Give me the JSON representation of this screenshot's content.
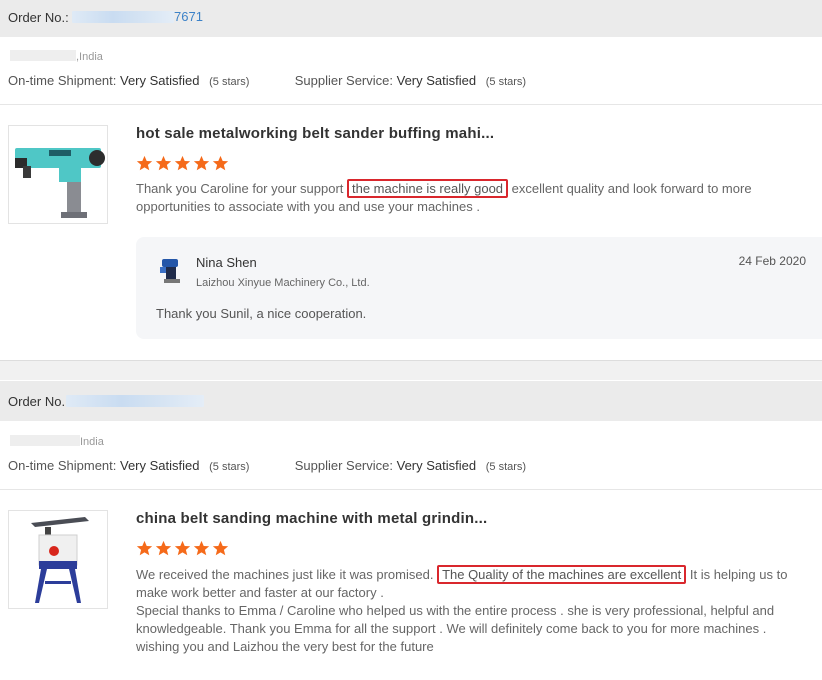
{
  "orders": [
    {
      "order_label": "Order No.:",
      "order_number_visible": "7671",
      "location": ",India",
      "ontime_label": "On-time Shipment:",
      "ontime_value": "Very Satisfied",
      "ontime_stars": "(5 stars)",
      "supplier_label": "Supplier Service:",
      "supplier_value": "Very Satisfied",
      "supplier_stars": "(5 stars)",
      "product_title": "hot sale metalworking belt sander buffing mahi...",
      "rating": 5,
      "review_before": "Thank you Caroline for your support ",
      "review_highlight": "the machine is really good",
      "review_after": " excellent quality and look forward to more opportunities to associate with you and use your machines .",
      "reply": {
        "name": "Nina Shen",
        "company": "Laizhou Xinyue Machinery Co., Ltd.",
        "date": "24 Feb 2020",
        "text": "Thank you Sunil, a nice cooperation."
      }
    },
    {
      "order_label": "Order No.",
      "location": "India",
      "ontime_label": "On-time Shipment:",
      "ontime_value": "Very Satisfied",
      "ontime_stars": "(5 stars)",
      "supplier_label": "Supplier Service:",
      "supplier_value": "Very Satisfied",
      "supplier_stars": "(5 stars)",
      "product_title": "china belt sanding machine with metal grindin...",
      "rating": 5,
      "review_before": "We received the machines just like it was promised. ",
      "review_highlight": "The Quality of the machines are excellent",
      "review_after": " It is helping us to make work better and faster at our factory .",
      "review_line2": "Special thanks to Emma / Caroline who helped us with the entire process . she is very professional, helpful and knowledgeable. Thank you Emma for all the support . We will definitely come back to you for more machines .",
      "review_line3": "wishing you and Laizhou the very best for the future"
    }
  ],
  "colors": {
    "star": "#f56a1a",
    "highlight_border": "#d9272d",
    "order_link": "#3c82c8"
  },
  "icons": {
    "star": "star-icon",
    "avatar": "supplier-avatar-icon"
  }
}
